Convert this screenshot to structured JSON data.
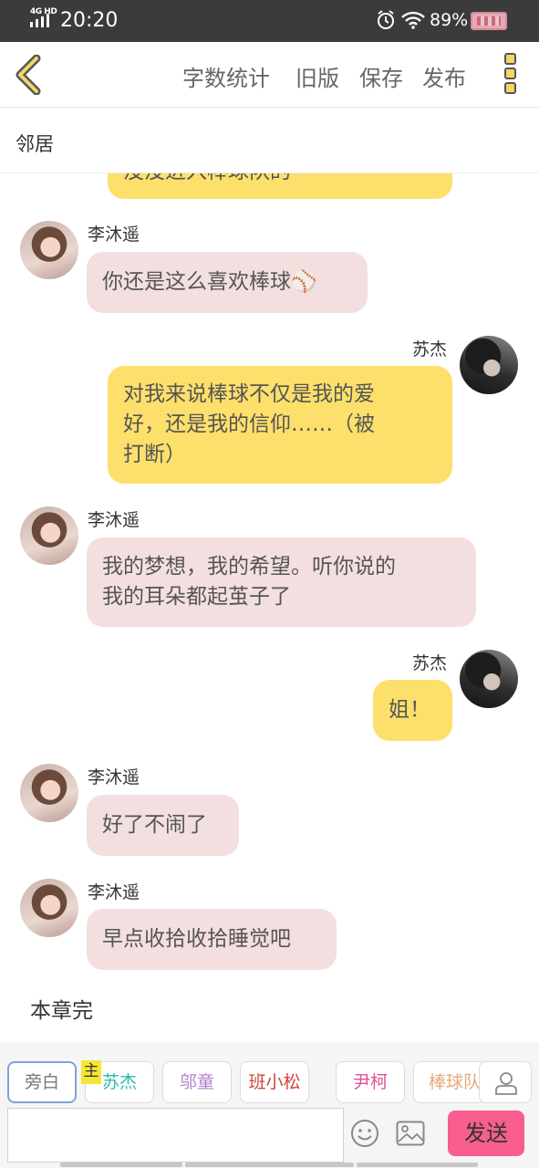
{
  "status_bar": {
    "network": "4G HD",
    "time": "20:20",
    "battery": "89%"
  },
  "toolbar": {
    "word_count": "字数统计",
    "old_version": "旧版",
    "save": "保存",
    "publish": "发布"
  },
  "chapter": {
    "title": "邻居"
  },
  "messages": [
    {
      "side": "right",
      "text": "没没进入棒球队的"
    },
    {
      "side": "left",
      "name": "李沐遥",
      "text": "你还是这么喜欢棒球⚾"
    },
    {
      "side": "right",
      "name": "苏杰",
      "text": "对我来说棒球不仅是我的爱好，还是我的信仰……（被打断）",
      "lines": [
        "对我来说棒球不仅是我的爱",
        "好，还是我的信仰……（被",
        "打断）"
      ]
    },
    {
      "side": "left",
      "name": "李沐遥",
      "text": "我的梦想，我的希望。听你说的我的耳朵都起茧子了",
      "lines": [
        "我的梦想，我的希望。听你说的",
        "我的耳朵都起茧子了"
      ]
    },
    {
      "side": "right",
      "name": "苏杰",
      "text": "姐！"
    },
    {
      "side": "left",
      "name": "李沐遥",
      "text": "好了不闹了"
    },
    {
      "side": "left",
      "name": "李沐遥",
      "text": "早点收拾收拾睡觉吧"
    }
  ],
  "end_text": "本章完",
  "characters": [
    {
      "label": "旁白",
      "color": "#777777"
    },
    {
      "label": "苏杰",
      "color": "#2bb9a8",
      "tag": "主"
    },
    {
      "label": "邬童",
      "color": "#b77fd0"
    },
    {
      "label": "班小松",
      "color": "#d0433e"
    },
    {
      "label": "尹柯",
      "color": "#e04f98"
    },
    {
      "label": "棒球队",
      "color": "#e8a87a"
    }
  ],
  "input": {
    "placeholder": ""
  },
  "send_button": "发送",
  "colors": {
    "left_bubble": "#f3dfe0",
    "right_bubble": "#fde06b",
    "send": "#f75e8e",
    "icon_accent": "#f3d768"
  }
}
